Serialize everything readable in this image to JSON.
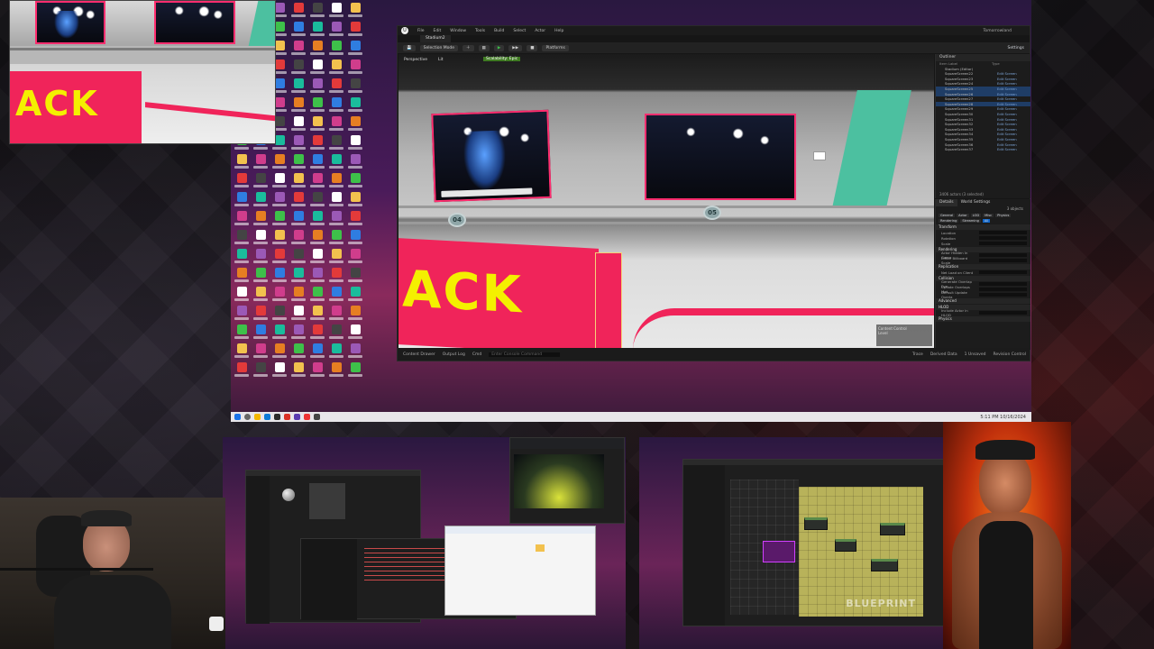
{
  "editor": {
    "menu": [
      "File",
      "Edit",
      "Window",
      "Tools",
      "Build",
      "Select",
      "Actor",
      "Help"
    ],
    "title": "Tomorrowland",
    "level_tab": "Stadium2",
    "settings_label": "Settings",
    "toolbar": {
      "mode": "Selection Mode",
      "platforms": "Platforms"
    },
    "viewport": {
      "view_mode": "Perspective",
      "lit": "Lit",
      "badge": "Scalability: Epic",
      "markers": [
        "04",
        "05"
      ],
      "sign_text": "ACK",
      "overlay_lines": [
        "Content Control",
        "Level"
      ]
    },
    "outliner": {
      "title": "Outliner",
      "col_label": "Item Label",
      "col_type": "Type",
      "rows": [
        {
          "name": "Stadium (Editor)",
          "type": "",
          "selected": false
        },
        {
          "name": "SquareScreen22",
          "type": "Edit Screen",
          "selected": false
        },
        {
          "name": "SquareScreen23",
          "type": "Edit Screen",
          "selected": false
        },
        {
          "name": "SquareScreen24",
          "type": "Edit Screen",
          "selected": false
        },
        {
          "name": "SquareScreen25",
          "type": "Edit Screen",
          "selected": true
        },
        {
          "name": "SquareScreen26",
          "type": "Edit Screen",
          "selected": true
        },
        {
          "name": "SquareScreen27",
          "type": "Edit Screen",
          "selected": false
        },
        {
          "name": "SquareScreen28",
          "type": "Edit Screen",
          "selected": true
        },
        {
          "name": "SquareScreen29",
          "type": "Edit Screen",
          "selected": false
        },
        {
          "name": "SquareScreen30",
          "type": "Edit Screen",
          "selected": false
        },
        {
          "name": "SquareScreen31",
          "type": "Edit Screen",
          "selected": false
        },
        {
          "name": "SquareScreen32",
          "type": "Edit Screen",
          "selected": false
        },
        {
          "name": "SquareScreen33",
          "type": "Edit Screen",
          "selected": false
        },
        {
          "name": "SquareScreen34",
          "type": "Edit Screen",
          "selected": false
        },
        {
          "name": "SquareScreen35",
          "type": "Edit Screen",
          "selected": false
        },
        {
          "name": "SquareScreen36",
          "type": "Edit Screen",
          "selected": false
        },
        {
          "name": "SquareScreen37",
          "type": "Edit Screen",
          "selected": false
        }
      ],
      "footer": "3406 actors (3 selected)"
    },
    "details": {
      "tabs": [
        "Details",
        "World Settings"
      ],
      "subtitle": "3 objects",
      "filters": [
        "General",
        "Actor",
        "LOD",
        "Misc",
        "Physics",
        "Rendering",
        "Streaming",
        "All"
      ],
      "sections": [
        {
          "title": "Transform",
          "rows": [
            "Location",
            "Rotation",
            "Scale"
          ]
        },
        {
          "title": "Rendering",
          "rows": [
            "Actor Hidden In Game",
            "Editor Billboard Scale"
          ]
        },
        {
          "title": "Replication",
          "rows": [
            "Net Load on Client"
          ]
        },
        {
          "title": "Collision",
          "rows": [
            "Generate Overlap Eve",
            "Update Overlaps Met",
            "Default Update Overla"
          ]
        },
        {
          "title": "Advanced",
          "rows": []
        },
        {
          "title": "HLOD",
          "rows": [
            "Include Actor in HLOD"
          ]
        },
        {
          "title": "Physics",
          "rows": []
        }
      ]
    },
    "bottom_bar": [
      "Content Drawer",
      "Output Log",
      "Cmd",
      "Enter Console Command"
    ],
    "status_right": [
      "Trace",
      "Derived Data",
      "1 Unsaved",
      "Revision Control"
    ]
  },
  "taskbar": {
    "time": "5:11 PM",
    "date": "10/16/2024"
  },
  "bottom_right_window": {
    "blueprint_watermark": "BLUEPRINT"
  },
  "colors": {
    "accent_pink": "#f0245a",
    "sign_yellow": "#f4f000",
    "teal": "#4cc0a0",
    "selection_blue": "#1f3d66"
  }
}
